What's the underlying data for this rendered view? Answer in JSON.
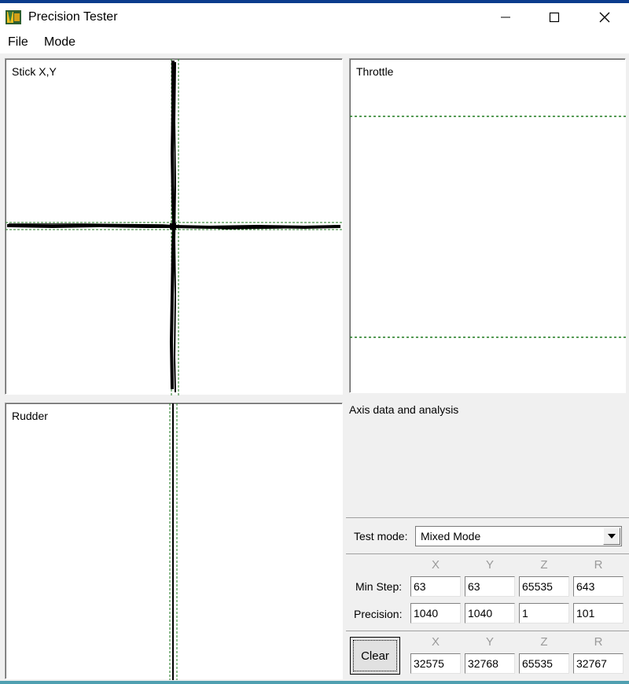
{
  "window": {
    "title": "Precision Tester",
    "minimize": "—",
    "maximize": "☐",
    "close": "✕"
  },
  "menu": {
    "items": [
      "File",
      "Mode"
    ]
  },
  "panels": {
    "stick_label": "Stick X,Y",
    "throttle_label": "Throttle",
    "rudder_label": "Rudder"
  },
  "analysis": {
    "label": "Axis data and analysis"
  },
  "test_mode": {
    "label": "Test mode:",
    "value": "Mixed Mode"
  },
  "stats": {
    "columns": [
      "X",
      "Y",
      "Z",
      "R"
    ],
    "rows": [
      {
        "label": "Min Step:",
        "values": [
          "63",
          "63",
          "65535",
          "643"
        ]
      },
      {
        "label": "Precision:",
        "values": [
          "1040",
          "1040",
          "1",
          "101"
        ]
      }
    ]
  },
  "current": {
    "clear_label": "Clear",
    "columns": [
      "X",
      "Y",
      "Z",
      "R"
    ],
    "values": [
      "32575",
      "32768",
      "65535",
      "32767"
    ]
  },
  "colors": {
    "trace": "#000000",
    "guide": "#1e7a1e",
    "title_bar_border": "#0b3c8c"
  }
}
